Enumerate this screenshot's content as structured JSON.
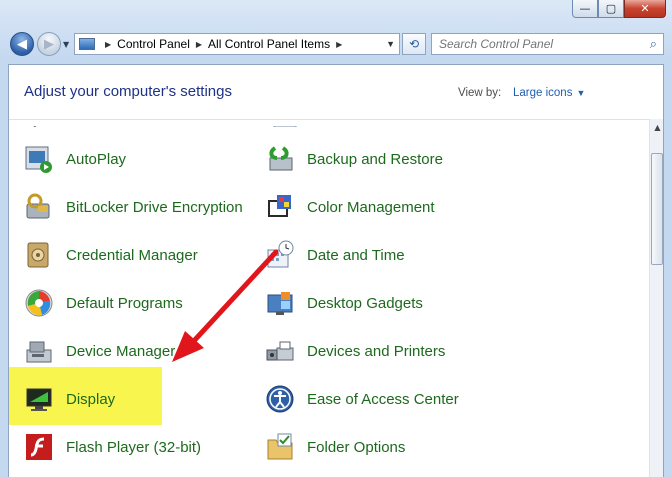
{
  "window": {
    "controls": {
      "minimize": "—",
      "maximize": "▢",
      "close": "✕"
    }
  },
  "nav": {
    "back_icon": "back-arrow-icon",
    "forward_icon": "forward-arrow-icon",
    "breadcrumb": [
      "Control Panel",
      "All Control Panel Items"
    ],
    "search_placeholder": "Search Control Panel"
  },
  "header": {
    "title": "Adjust your computer's settings",
    "view_by_label": "View by:",
    "view_by_value": "Large icons"
  },
  "items_left": [
    {
      "label": "AutoPlay",
      "icon": "autoplay-icon"
    },
    {
      "label": "BitLocker Drive Encryption",
      "icon": "bitlocker-icon"
    },
    {
      "label": "Credential Manager",
      "icon": "credential-manager-icon"
    },
    {
      "label": "Default Programs",
      "icon": "default-programs-icon"
    },
    {
      "label": "Device Manager",
      "icon": "device-manager-icon"
    },
    {
      "label": "Display",
      "icon": "display-icon"
    },
    {
      "label": "Flash Player (32-bit)",
      "icon": "flash-player-icon"
    }
  ],
  "items_right": [
    {
      "label": "Backup and Restore",
      "icon": "backup-restore-icon"
    },
    {
      "label": "Color Management",
      "icon": "color-management-icon"
    },
    {
      "label": "Date and Time",
      "icon": "date-time-icon"
    },
    {
      "label": "Desktop Gadgets",
      "icon": "desktop-gadgets-icon"
    },
    {
      "label": "Devices and Printers",
      "icon": "devices-printers-icon"
    },
    {
      "label": "Ease of Access Center",
      "icon": "ease-of-access-icon"
    },
    {
      "label": "Folder Options",
      "icon": "folder-options-icon"
    }
  ],
  "annotation": {
    "color": "#e0161b",
    "highlight_color": "#f8f64e"
  }
}
